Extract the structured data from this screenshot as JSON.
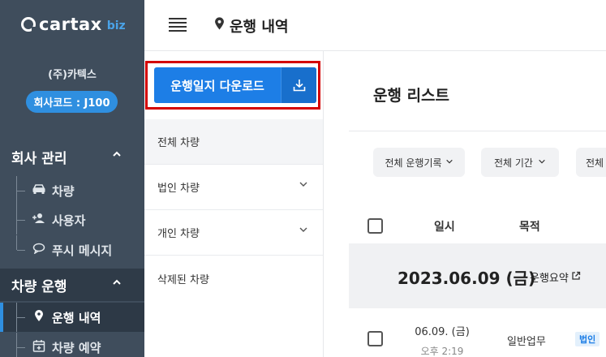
{
  "logo": {
    "text": "cartax",
    "suffix": "biz"
  },
  "company": {
    "name": "(주)카텍스",
    "code_badge": "회사코드 : J100"
  },
  "sidebar": {
    "sections": [
      {
        "label": "회사 관리",
        "items": [
          {
            "label": "차량",
            "icon": "car-icon"
          },
          {
            "label": "사용자",
            "icon": "user-add-icon"
          },
          {
            "label": "푸시 메시지",
            "icon": "chat-bubble-icon"
          }
        ]
      },
      {
        "label": "차량 운행",
        "items": [
          {
            "label": "운행 내역",
            "icon": "location-pin-icon",
            "active": true
          },
          {
            "label": "차량 예약",
            "icon": "calendar-add-icon"
          }
        ]
      }
    ]
  },
  "header": {
    "title": "운행 내역"
  },
  "panel": {
    "download_label": "운행일지 다운로드",
    "categories": [
      {
        "label": "전체 차량"
      },
      {
        "label": "법인 차량"
      },
      {
        "label": "개인 차량"
      },
      {
        "label": "삭제된 차량"
      }
    ]
  },
  "main": {
    "title": "운행 리스트",
    "filters": [
      "전체 운행기록",
      "전체 기간",
      "전체"
    ],
    "columns": {
      "date": "일시",
      "purpose": "목적"
    },
    "group": {
      "date": "2023.06.09 (금)",
      "summary": "운행요약"
    },
    "rows": [
      {
        "date": "06.09. (금)",
        "time": "오후 2:19",
        "purpose": "일반업무",
        "badge": "법인"
      }
    ]
  },
  "colors": {
    "sidebar": "#3f4d5c",
    "accent": "#1d7ee6",
    "highlight_frame": "#d40000"
  }
}
